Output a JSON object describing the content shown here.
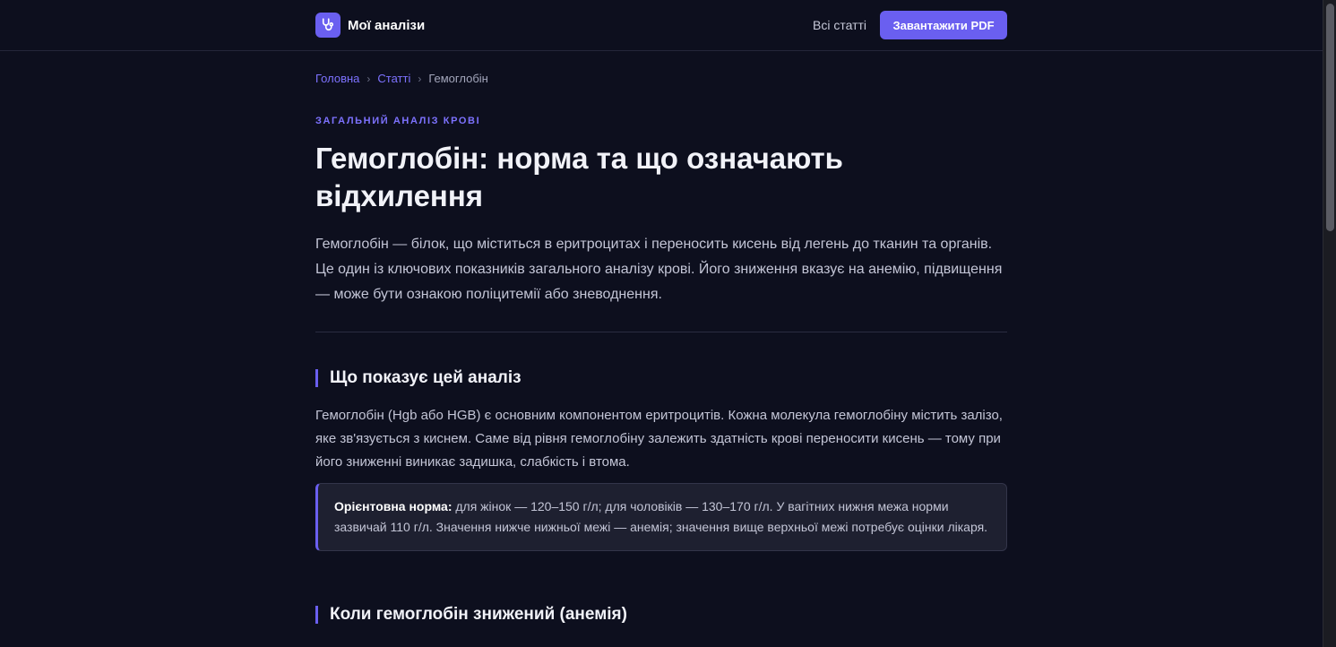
{
  "header": {
    "brand_name": "Мої аналізи",
    "nav_all_articles": "Всі статті",
    "download_pdf": "Завантажити PDF"
  },
  "breadcrumb": {
    "home": "Головна",
    "articles": "Статті",
    "current": "Гемоглобін",
    "separator": "›"
  },
  "article": {
    "category": "ЗАГАЛЬНИЙ АНАЛІЗ КРОВІ",
    "title": "Гемоглобін: норма та що означають відхилення",
    "lead": "Гемоглобін — білок, що міститься в еритроцитах і переносить кисень від легень до тканин та органів. Це один із ключових показників загального аналізу крові. Його зниження вказує на анемію, підвищення — може бути ознакою поліцитемії або зневоднення.",
    "sections": [
      {
        "heading": "Що показує цей аналіз",
        "text": "Гемоглобін (Hgb або HGB) є основним компонентом еритроцитів. Кожна молекула гемоглобіну містить залізо, яке зв'язується з киснем. Саме від рівня гемоглобіну залежить здатність крові переносити кисень — тому при його зниженні виникає задишка, слабкість і втома."
      },
      {
        "heading": "Коли гемоглобін знижений (анемія)"
      }
    ],
    "callout": {
      "label": "Орієнтовна норма:",
      "text": " для жінок — 120–150 г/л; для чоловіків — 130–170 г/л. У вагітних нижня межа норми зазвичай 110 г/л. Значення нижче нижньої межі — анемія; значення вище верхньої межі потребує оцінки лікаря."
    }
  },
  "colors": {
    "accent": "#6a5ff0",
    "background": "#0d0f1e",
    "callout_bg": "#1e2030",
    "link": "#7d72ff"
  },
  "icons": {
    "brand": "stethoscope-icon"
  }
}
